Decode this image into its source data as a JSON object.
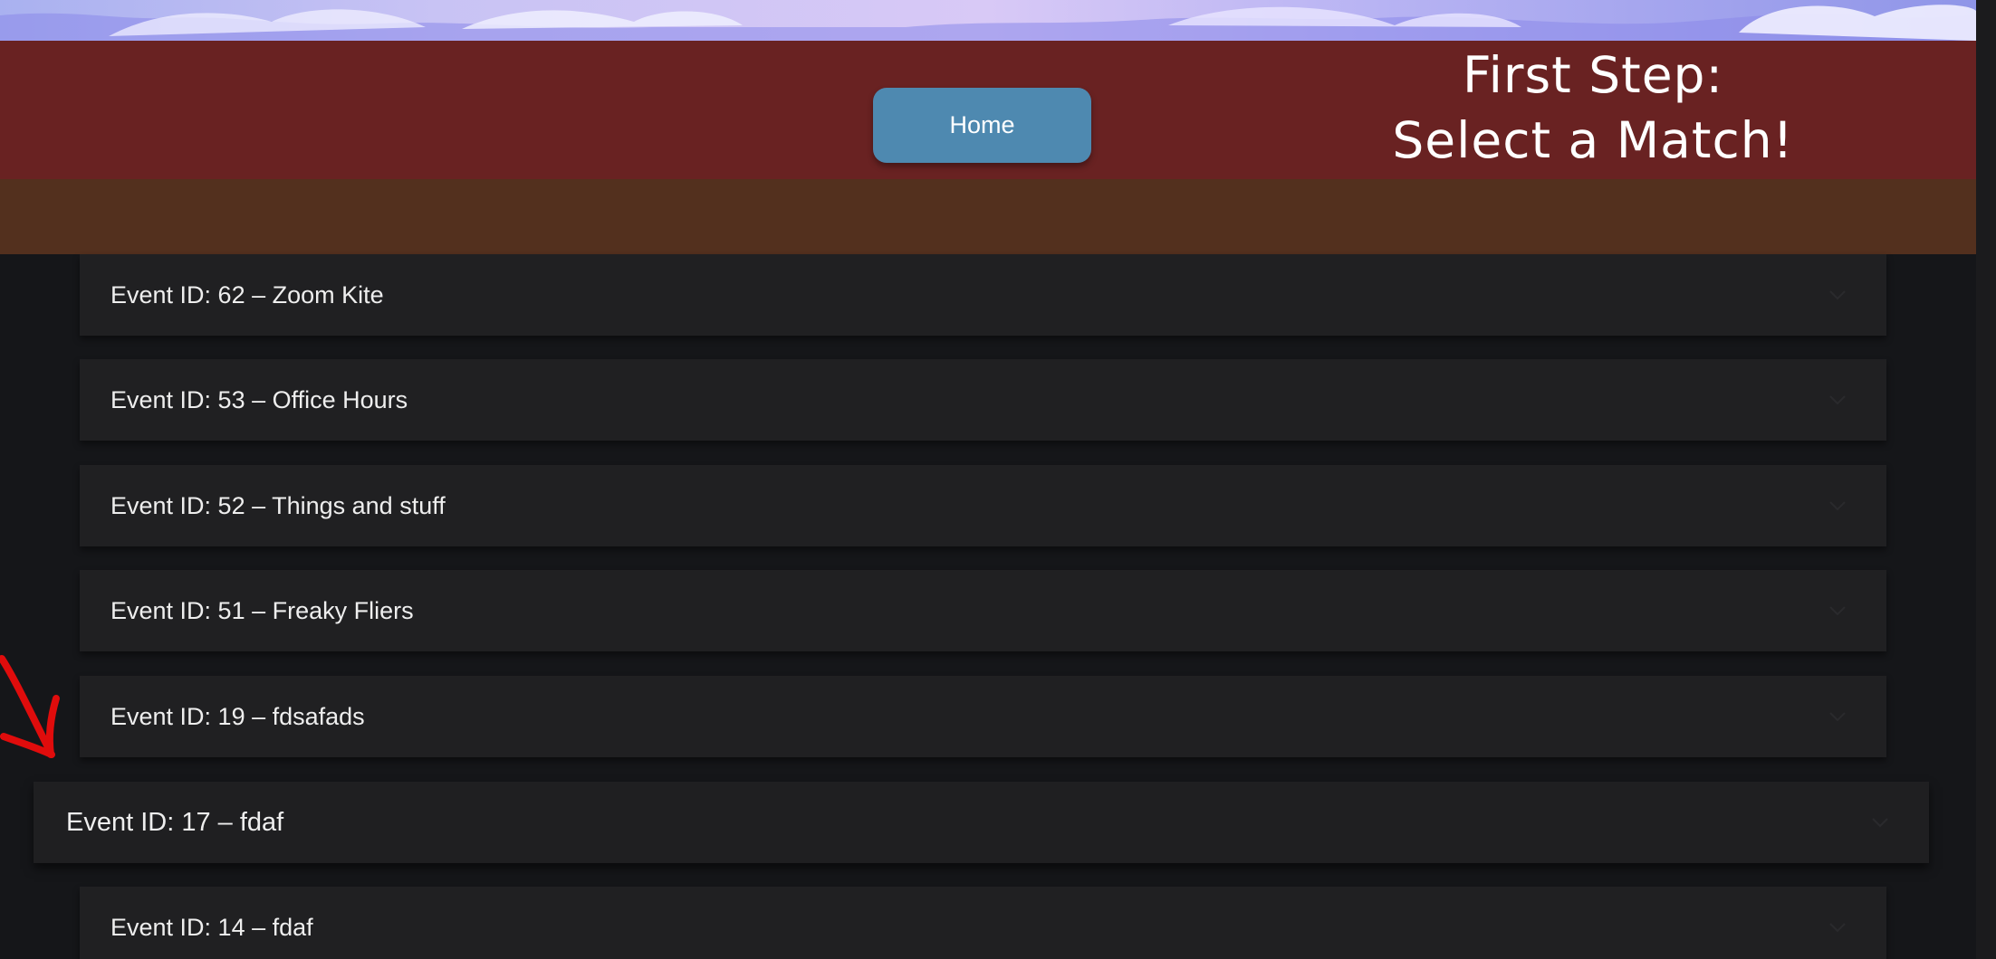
{
  "header": {
    "home_button_label": "Home",
    "heading_line1": "First Step:",
    "heading_line2": "Select a Match!"
  },
  "events": [
    {
      "label": "Event ID: 62 – Zoom Kite"
    },
    {
      "label": "Event ID: 53 – Office Hours"
    },
    {
      "label": "Event ID: 52 – Things and stuff"
    },
    {
      "label": "Event ID: 51 – Freaky Fliers"
    },
    {
      "label": "Event ID: 19 – fdsafads"
    },
    {
      "label": "Event ID: 17 – fdaf"
    },
    {
      "label": "Event ID: 14 – fdaf"
    }
  ],
  "highlighted_event_index": 5,
  "icons": {
    "expand": "chevron-down-icon",
    "annotation": "red-arrow-annotation"
  },
  "colors": {
    "header_background": "#692222",
    "brown_strip": "#53301e",
    "home_button": "#4e89b0",
    "list_row": "#202022",
    "annotation_arrow": "#e00c0c"
  }
}
